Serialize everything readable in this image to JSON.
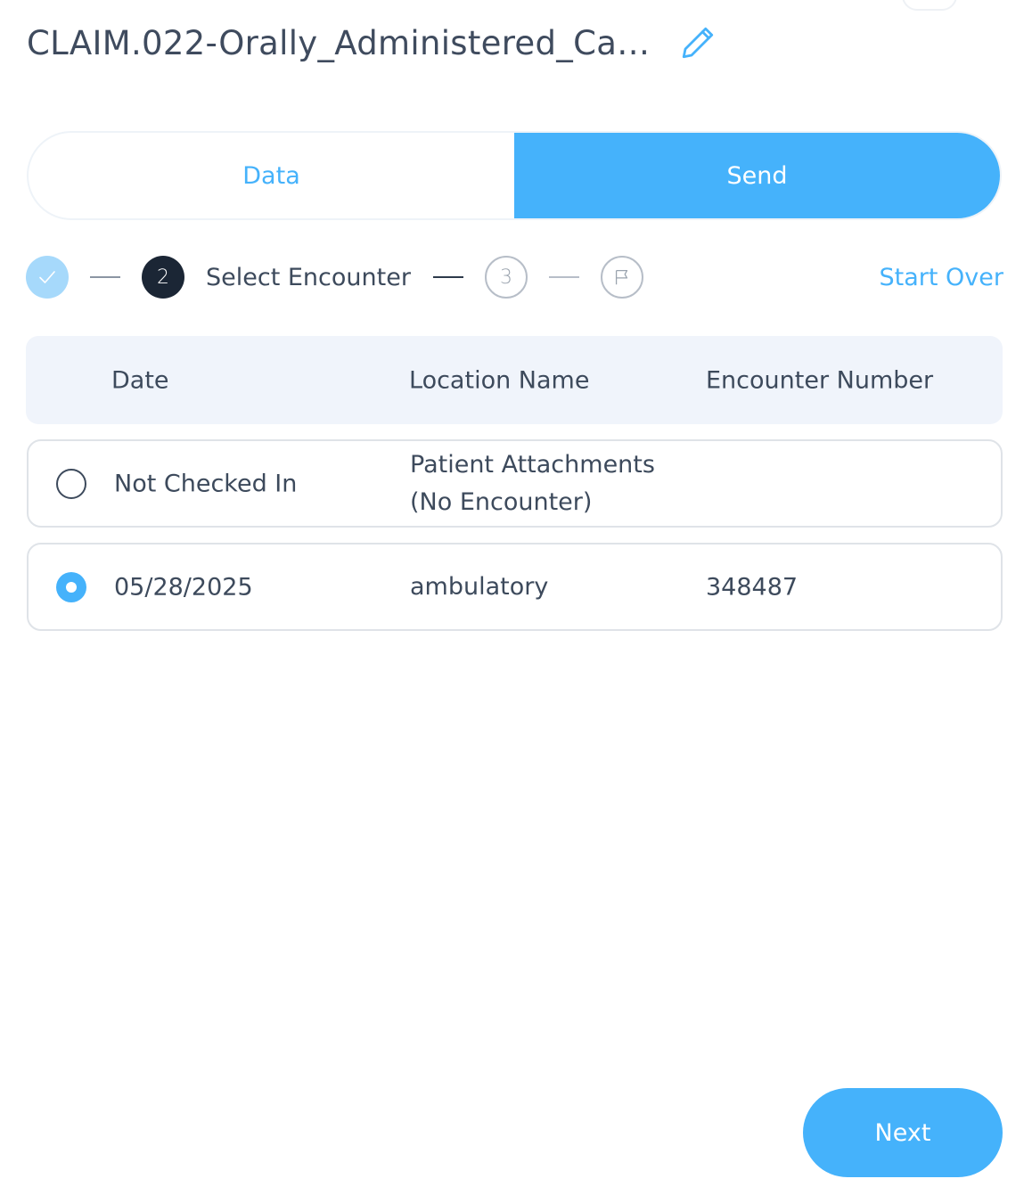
{
  "header": {
    "title": "CLAIM.022-Orally_Administered_Ca…",
    "edit_icon": "pencil-icon"
  },
  "tabs": [
    {
      "label": "Data",
      "active": false
    },
    {
      "label": "Send",
      "active": true
    }
  ],
  "stepper": {
    "steps": [
      {
        "state": "complete",
        "icon": "check-icon"
      },
      {
        "number": "2",
        "label": "Select Encounter",
        "state": "active"
      },
      {
        "number": "3",
        "state": "upcoming"
      },
      {
        "state": "upcoming",
        "icon": "flag-icon"
      }
    ],
    "start_over_label": "Start Over"
  },
  "table": {
    "columns": [
      "Date",
      "Location Name",
      "Encounter Number"
    ],
    "rows": [
      {
        "date": "Not Checked In",
        "location_line1": "Patient Attachments",
        "location_line2": "(No Encounter)",
        "encounter_number": "",
        "selected": false
      },
      {
        "date": "05/28/2025",
        "location": "ambulatory",
        "encounter_number": "348487",
        "selected": true
      }
    ]
  },
  "footer": {
    "next_label": "Next"
  },
  "colors": {
    "accent": "#45b2fb",
    "accent_light": "#a6d9fb",
    "dark": "#1b2635",
    "text": "#3d4a5c",
    "header_bg": "#f0f4fb"
  }
}
